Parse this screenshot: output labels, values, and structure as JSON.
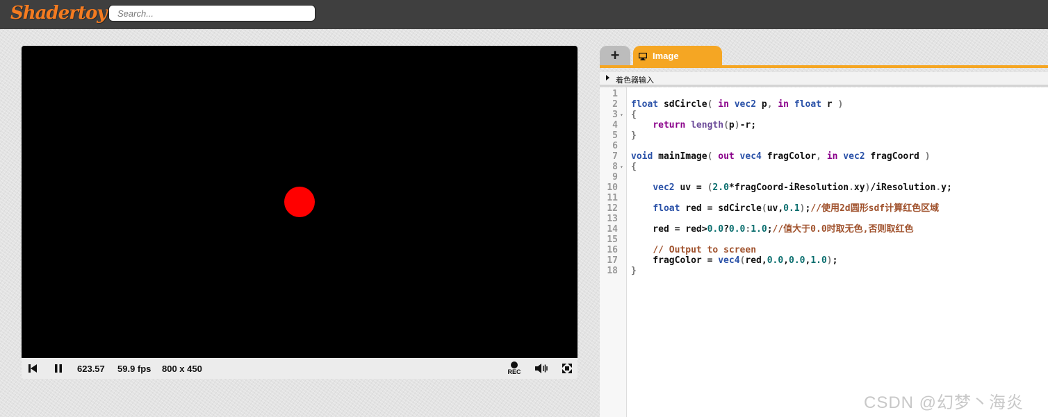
{
  "header": {
    "logo": "Shadertoy",
    "search_placeholder": "Search..."
  },
  "player": {
    "time": "623.57",
    "fps": "59.9 fps",
    "resolution": "800 x 450",
    "rec_label": "REC",
    "circle_color": "#ff0000"
  },
  "editor": {
    "add_tab_label": "+",
    "tab_label": "Image",
    "inputs_label": "着色器输入",
    "accent": "#f5a623",
    "code_lines": [
      {
        "n": "1",
        "fold": "",
        "tokens": []
      },
      {
        "n": "2",
        "fold": "",
        "tokens": [
          [
            "ty",
            "float"
          ],
          [
            "fn",
            " sdCircle"
          ],
          [
            "pu",
            "( "
          ],
          [
            "kw",
            "in"
          ],
          [
            "ty",
            " vec2"
          ],
          [
            "fn",
            " p"
          ],
          [
            "pu",
            ", "
          ],
          [
            "kw",
            "in"
          ],
          [
            "ty",
            " float"
          ],
          [
            "fn",
            " r"
          ],
          [
            "pu",
            " )"
          ]
        ]
      },
      {
        "n": "3",
        "fold": "▾",
        "tokens": [
          [
            "pu",
            "{"
          ]
        ]
      },
      {
        "n": "4",
        "fold": "",
        "tokens": [
          [
            "fn",
            "    "
          ],
          [
            "kw",
            "return"
          ],
          [
            "fn",
            " "
          ],
          [
            "pr",
            "length"
          ],
          [
            "pu",
            "("
          ],
          [
            "fn",
            "p"
          ],
          [
            "pu",
            ")"
          ],
          [
            "fn",
            "-r;"
          ]
        ]
      },
      {
        "n": "5",
        "fold": "",
        "tokens": [
          [
            "pu",
            "}"
          ]
        ]
      },
      {
        "n": "6",
        "fold": "",
        "tokens": []
      },
      {
        "n": "7",
        "fold": "",
        "tokens": [
          [
            "ty",
            "void"
          ],
          [
            "fn",
            " mainImage"
          ],
          [
            "pu",
            "( "
          ],
          [
            "kw",
            "out"
          ],
          [
            "ty",
            " vec4"
          ],
          [
            "fn",
            " fragColor"
          ],
          [
            "pu",
            ", "
          ],
          [
            "kw",
            "in"
          ],
          [
            "ty",
            " vec2"
          ],
          [
            "fn",
            " fragCoord"
          ],
          [
            "pu",
            " )"
          ]
        ]
      },
      {
        "n": "8",
        "fold": "▾",
        "tokens": [
          [
            "pu",
            "{"
          ]
        ]
      },
      {
        "n": "9",
        "fold": "",
        "tokens": []
      },
      {
        "n": "10",
        "fold": "",
        "tokens": [
          [
            "fn",
            "    "
          ],
          [
            "ty",
            "vec2"
          ],
          [
            "fn",
            " uv = "
          ],
          [
            "pu",
            "("
          ],
          [
            "nm",
            "2.0"
          ],
          [
            "fn",
            "*fragCoord-iResolution"
          ],
          [
            "pu",
            "."
          ],
          [
            "fn",
            "xy"
          ],
          [
            "pu",
            ")"
          ],
          [
            "fn",
            "/iResolution"
          ],
          [
            "pu",
            "."
          ],
          [
            "fn",
            "y;"
          ]
        ]
      },
      {
        "n": "11",
        "fold": "",
        "tokens": []
      },
      {
        "n": "12",
        "fold": "",
        "tokens": [
          [
            "fn",
            "    "
          ],
          [
            "ty",
            "float"
          ],
          [
            "fn",
            " red = sdCircle"
          ],
          [
            "pu",
            "("
          ],
          [
            "fn",
            "uv,"
          ],
          [
            "nm",
            "0.1"
          ],
          [
            "pu",
            ")"
          ],
          [
            "fn",
            ";"
          ],
          [
            "cm",
            "//使用2d圆形sdf计算红色区域"
          ]
        ]
      },
      {
        "n": "13",
        "fold": "",
        "tokens": []
      },
      {
        "n": "14",
        "fold": "",
        "tokens": [
          [
            "fn",
            "    red = red>"
          ],
          [
            "nm",
            "0.0"
          ],
          [
            "fn",
            "?"
          ],
          [
            "nm",
            "0.0"
          ],
          [
            "pu",
            ":"
          ],
          [
            "nm",
            "1.0"
          ],
          [
            "fn",
            ";"
          ],
          [
            "cm",
            "//值大于0.0时取无色,否则取红色"
          ]
        ]
      },
      {
        "n": "15",
        "fold": "",
        "tokens": []
      },
      {
        "n": "16",
        "fold": "",
        "tokens": [
          [
            "fn",
            "    "
          ],
          [
            "cm",
            "// Output to screen"
          ]
        ]
      },
      {
        "n": "17",
        "fold": "",
        "tokens": [
          [
            "fn",
            "    fragColor = "
          ],
          [
            "ty",
            "vec4"
          ],
          [
            "pu",
            "("
          ],
          [
            "fn",
            "red,"
          ],
          [
            "nm",
            "0.0"
          ],
          [
            "fn",
            ","
          ],
          [
            "nm",
            "0.0"
          ],
          [
            "fn",
            ","
          ],
          [
            "nm",
            "1.0"
          ],
          [
            "pu",
            ")"
          ],
          [
            "fn",
            ";"
          ]
        ]
      },
      {
        "n": "18",
        "fold": "",
        "tokens": [
          [
            "pu",
            "}"
          ]
        ]
      }
    ]
  },
  "watermark": "CSDN @幻梦丶海炎"
}
